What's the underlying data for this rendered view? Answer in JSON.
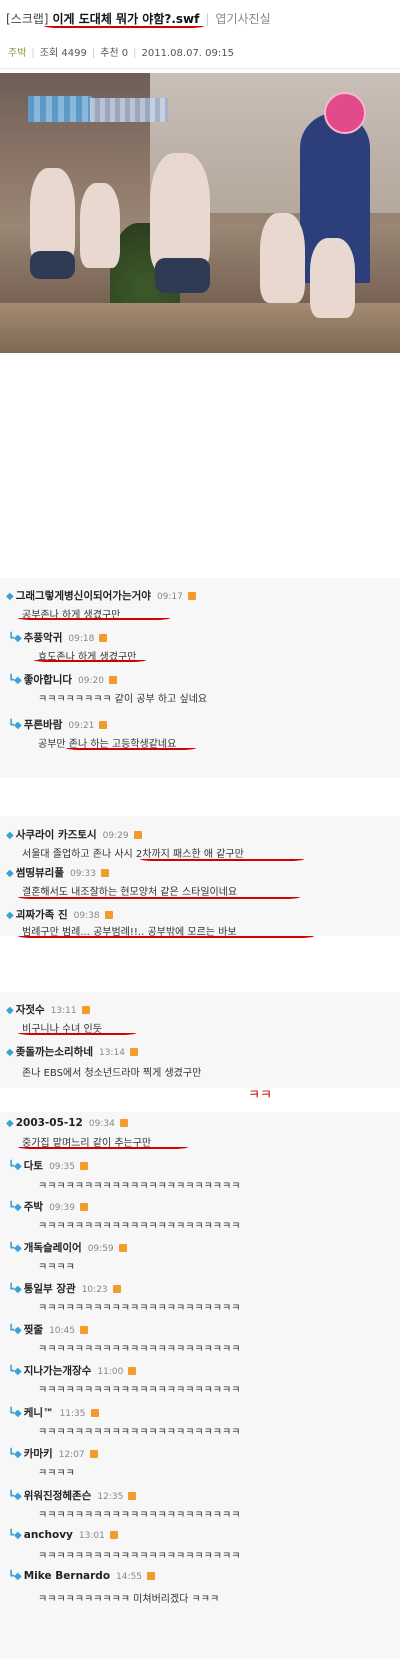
{
  "post": {
    "tag": "[스크랩]",
    "title": "이게 도대체 뭐가 야함?.swf",
    "board": "엽기사진실",
    "author": "주박",
    "views_label": "조회",
    "views": "4499",
    "recommend_label": "추천",
    "recommend": "0",
    "datetime": "2011.08.07. 09:15"
  },
  "colors": {
    "accent_underline": "#d40000",
    "gem": "#3aa0d8",
    "new_badge": "#f39b2b"
  },
  "groups": [
    {
      "comments": [
        {
          "nick": "그래그렇게병신이되어가는거야",
          "time": "09:17",
          "text": "공부존나 하게 생겼구만"
        },
        {
          "nick": "추풍악귀",
          "time": "09:18",
          "text": "효도존나 하게 생겼구만",
          "reply": true
        },
        {
          "nick": "좋아합니다",
          "time": "09:20",
          "text": "ㅋㅋㅋㅋㅋㅋㅋㅋ 같이 공부 하고 싶네요",
          "reply": true
        },
        {
          "nick": "푸른바람",
          "time": "09:21",
          "text": "공부만 존나 하는 고등학생같네요",
          "reply": true
        }
      ]
    },
    {
      "comments": [
        {
          "nick": "사쿠라이 카즈토시",
          "time": "09:29",
          "text": "서울대 졸업하고 존나 사시 2차까지 패스한 애 같구만"
        },
        {
          "nick": "썸띵뷰리풀",
          "time": "09:33",
          "text": "결혼해서도 내조잘하는 현모양처 같은 스타일이네요"
        },
        {
          "nick": "괴짜가족 진",
          "time": "09:38",
          "text": "범례구만 범례... 공부범례!!.. 공부밖에 모르는 바보"
        }
      ]
    },
    {
      "comments": [
        {
          "nick": "자젓수",
          "time": "13:11",
          "text": "비구니나 수녀 인듯"
        },
        {
          "nick": "좆돌까는소리하네",
          "time": "13:14",
          "text": "존나 EBS에서 청소년드라마 찍게 생겼구만"
        }
      ]
    },
    {
      "comments": [
        {
          "nick": "2003-05-12",
          "time": "09:34",
          "text": "중가집 맡며느리 같이 추는구만"
        },
        {
          "nick": "다토",
          "time": "09:35",
          "text": "ㅋㅋㅋㅋㅋㅋㅋㅋㅋㅋㅋㅋㅋㅋㅋㅋㅋㅋㅋㅋㅋㅋ",
          "reply": true
        },
        {
          "nick": "주박",
          "time": "09:39",
          "text": "ㅋㅋㅋㅋㅋㅋㅋㅋㅋㅋㅋㅋㅋㅋㅋㅋㅋㅋㅋㅋㅋㅋ",
          "reply": true
        },
        {
          "nick": "개독슬레이어",
          "time": "09:59",
          "text": "ㅋㅋㅋㅋ",
          "reply": true
        },
        {
          "nick": "통일부 장관",
          "time": "10:23",
          "text": "ㅋㅋㅋㅋㅋㅋㅋㅋㅋㅋㅋㅋㅋㅋㅋㅋㅋㅋㅋㅋㅋㅋ",
          "reply": true
        },
        {
          "nick": "찢줄",
          "time": "10:45",
          "text": "ㅋㅋㅋㅋㅋㅋㅋㅋㅋㅋㅋㅋㅋㅋㅋㅋㅋㅋㅋㅋㅋㅋ",
          "reply": true
        },
        {
          "nick": "지나가는개장수",
          "time": "11:00",
          "text": "ㅋㅋㅋㅋㅋㅋㅋㅋㅋㅋㅋㅋㅋㅋㅋㅋㅋㅋㅋㅋㅋㅋ",
          "reply": true
        },
        {
          "nick": "케니™",
          "time": "11:35",
          "text": "ㅋㅋㅋㅋㅋㅋㅋㅋㅋㅋㅋㅋㅋㅋㅋㅋㅋㅋㅋㅋㅋㅋ",
          "reply": true
        },
        {
          "nick": "카마키",
          "time": "12:07",
          "text": "ㅋㅋㅋㅋ",
          "reply": true
        },
        {
          "nick": "위워진정헤존슨",
          "time": "12:35",
          "text": "ㅋㅋㅋㅋㅋㅋㅋㅋㅋㅋㅋㅋㅋㅋㅋㅋㅋㅋㅋㅋㅋㅋ",
          "reply": true
        },
        {
          "nick": "anchovy",
          "time": "13:01",
          "text": "ㅋㅋㅋㅋㅋㅋㅋㅋㅋㅋㅋㅋㅋㅋㅋㅋㅋㅋㅋㅋㅋㅋ",
          "reply": true
        },
        {
          "nick": "Mike Bernardo",
          "time": "14:55",
          "text": "ㅋㅋㅋㅋㅋㅋㅋㅋㅋㅋ 미쳐버리겠다 ㅋㅋㅋ",
          "reply": true
        }
      ]
    }
  ],
  "annotation": "ㅋㅋ"
}
